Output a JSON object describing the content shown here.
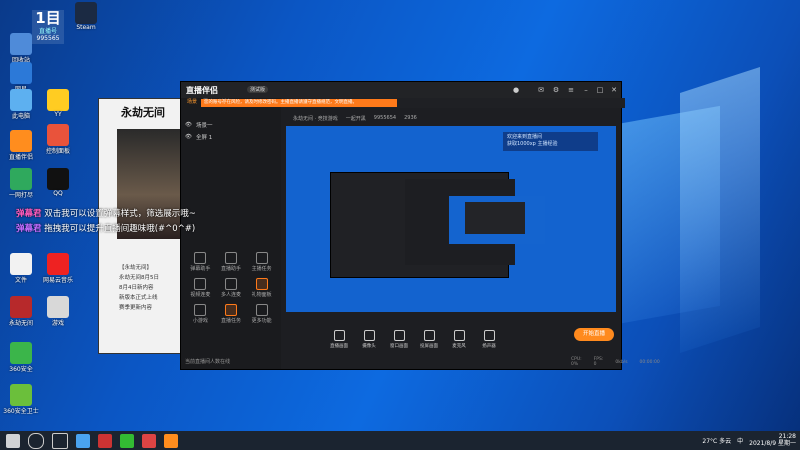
{
  "desktop": {
    "badge": {
      "line1": "1目",
      "line2": "直播号",
      "line3": "995565"
    },
    "icons": [
      {
        "label": "回收站",
        "icon": "recycle-bin-icon",
        "color": "#4f8bd9"
      },
      {
        "label": "Steam",
        "icon": "steam-icon",
        "color": "#1b2a43"
      },
      {
        "label": "网易",
        "icon": "mail-icon",
        "color": "#2c79d8"
      },
      {
        "label": "此电脑",
        "icon": "computer-icon",
        "color": "#5db0f0"
      },
      {
        "label": "YY",
        "icon": "yy-icon",
        "color": "#ffcc22"
      },
      {
        "label": "控制面板",
        "icon": "control-panel-icon",
        "color": "#e9533b"
      },
      {
        "label": "直播伴侣",
        "icon": "stream-companion-icon",
        "color": "#ff8d1e"
      },
      {
        "label": "一网打尽",
        "icon": "globe-icon",
        "color": "#2fa95d"
      },
      {
        "label": "QQ",
        "icon": "qq-icon",
        "color": "#111111"
      },
      {
        "label": "文件",
        "icon": "file-icon",
        "color": "#f2f2f2"
      },
      {
        "label": "网易云音乐",
        "icon": "music-icon",
        "color": "#e22"
      },
      {
        "label": "永劫无间",
        "icon": "game-icon",
        "color": "#b7292b"
      },
      {
        "label": "游戏",
        "icon": "game2-icon",
        "color": "#d8d8d8"
      },
      {
        "label": "360安全",
        "icon": "security-icon",
        "color": "#3bb54a"
      },
      {
        "label": "360安全卫士",
        "icon": "shield-icon",
        "color": "#6bbf3b"
      }
    ]
  },
  "chat": [
    {
      "user": "弹幕君",
      "text": "双击我可以设置弹幕样式，筛选展示哦~"
    },
    {
      "user": "弹幕君",
      "text": "拖拽我可以提升直播间趣味哦(#^0^#)"
    }
  ],
  "game": {
    "title": "永劫无间",
    "lines": [
      "【永劫无间】",
      "永劫无间8月5日",
      "8月4日新内容",
      "新版本正式上线",
      "赛季更新内容"
    ]
  },
  "app": {
    "name": "直播伴侣",
    "version": "测试版",
    "notice": "您的账号存在风险，请及时修改密码。主播直播请遵守直播规范，文明直播。",
    "tabs": [
      "场景",
      "互动",
      "计划"
    ],
    "scene_label": "场景1",
    "scene_items": [
      "场景一",
      "全屏 1"
    ],
    "topbar": [
      "不知道的",
      "精彩直播",
      "大屏",
      "直播设置",
      "横屏"
    ],
    "info": {
      "left": "永劫无间 · 竞技游戏",
      "fans": "一起开黑",
      "id": "9955654",
      "hot": "2936"
    },
    "overlay": {
      "line1": "欢迎来到直播间",
      "line2": "获取1000xp 主播经验"
    },
    "grid": [
      {
        "label": "弹幕助手",
        "orange": false
      },
      {
        "label": "直播助手",
        "orange": false
      },
      {
        "label": "主播任务",
        "orange": false
      },
      {
        "label": "视频连麦",
        "orange": false
      },
      {
        "label": "多人连麦",
        "orange": false
      },
      {
        "label": "礼物面板",
        "orange": true
      },
      {
        "label": "小游戏",
        "orange": false
      },
      {
        "label": "直播任务",
        "orange": true
      },
      {
        "label": "更多功能",
        "orange": false
      }
    ],
    "left_footer": "当前直播间人数在线",
    "controls": [
      "直播画面",
      "摄像头",
      "窗口画面",
      "投屏画面",
      "麦克风",
      "扬声器"
    ],
    "golive": "开始直播",
    "status": {
      "cpu": "CPU: 0%",
      "fps": "FPS: 0",
      "bitrate": "0kb/s",
      "time": "00:00:00"
    }
  },
  "taskbar": {
    "weather": "27°C 多云",
    "lang": "中",
    "time": "21:28",
    "date": "2021/8/9 星期一"
  }
}
